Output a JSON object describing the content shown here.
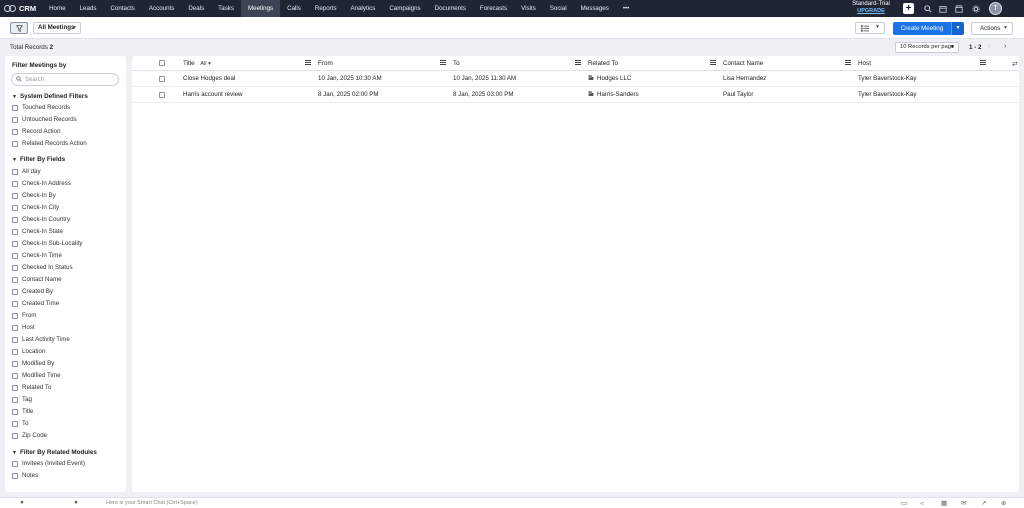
{
  "app": {
    "logo_text": "CRM"
  },
  "nav": {
    "items": [
      "Home",
      "Leads",
      "Contacts",
      "Accounts",
      "Deals",
      "Tasks",
      "Meetings",
      "Calls",
      "Reports",
      "Analytics",
      "Campaigns",
      "Documents",
      "Forecasts",
      "Visits",
      "Social",
      "Messages",
      "•••"
    ],
    "active": "Meetings"
  },
  "trial": {
    "line1": "Standard-Trial",
    "line2": "UPGRADE"
  },
  "user": {
    "avatar_initial": "T"
  },
  "toolbar": {
    "view_label": "All Meetings",
    "create_label": "Create Meeting",
    "actions_label": "Actions"
  },
  "records": {
    "total_label": "Total Records",
    "total_count": "2",
    "per_page": "10 Records per page",
    "range": "1 - 2"
  },
  "sidebar": {
    "title": "Filter Meetings by",
    "search_placeholder": "Search",
    "system_title": "System Defined Filters",
    "system_filters": [
      "Touched Records",
      "Untouched Records",
      "Record Action",
      "Related Records Action"
    ],
    "fields_title": "Filter By Fields",
    "field_filters": [
      "All day",
      "Check-In Address",
      "Check-In By",
      "Check-In City",
      "Check-In Country",
      "Check-In State",
      "Check-In Sub-Locality",
      "Check-In Time",
      "Checked In Status",
      "Contact Name",
      "Created By",
      "Created Time",
      "From",
      "Host",
      "Last Activity Time",
      "Location",
      "Modified By",
      "Modified Time",
      "Related To",
      "Tag",
      "Title",
      "To",
      "Zip Code"
    ],
    "modules_title": "Filter By Related Modules",
    "module_filters": [
      "Invitees (Invited Event)",
      "Notes"
    ]
  },
  "table": {
    "title_filter": "All",
    "columns": [
      "Title",
      "From",
      "To",
      "Related To",
      "Contact Name",
      "Host"
    ],
    "rows": [
      {
        "title": "Close Hodges deal",
        "from": "10 Jan, 2025 10:30 AM",
        "to": "10 Jan, 2025 11:30 AM",
        "related": "Hodges LLC",
        "contact": "Lisa Hernandez",
        "host": "Tyler Baverstock-Kay"
      },
      {
        "title": "Harris account review",
        "from": "8 Jan, 2025 02:00 PM",
        "to": "8 Jan, 2025 03:00 PM",
        "related": "Harris-Sanders",
        "contact": "Paul Taylor",
        "host": "Tyler Baverstock-Kay"
      }
    ]
  },
  "bottombar": {
    "chat_placeholder": "Here is your Smart Chat (Ctrl+Space)"
  }
}
